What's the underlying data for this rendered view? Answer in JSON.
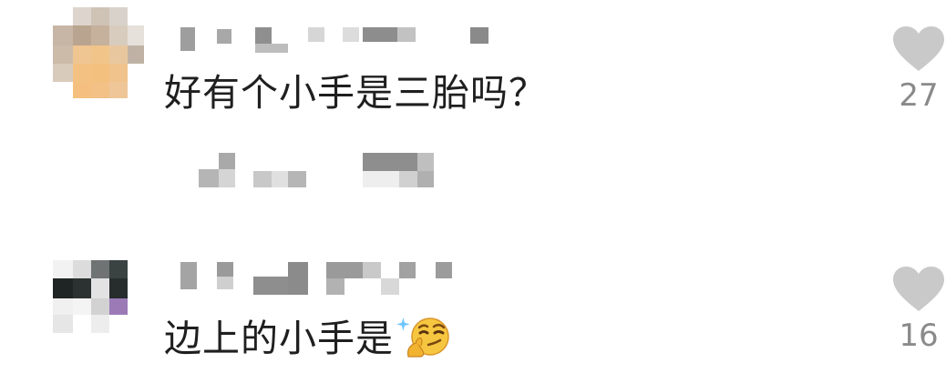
{
  "comments": [
    {
      "text": "好有个小手是三胎吗？",
      "like_count": "27",
      "icons": {
        "like": "heart-icon"
      }
    },
    {
      "text": "边上的小手是",
      "emoji": "smirk-thinking-emoji",
      "like_count": "16",
      "icons": {
        "like": "heart-icon"
      }
    }
  ],
  "colors": {
    "text": "#1f1f1f",
    "muted": "#8a8a8a",
    "heart": "#c9c9c9",
    "background": "#ffffff"
  }
}
